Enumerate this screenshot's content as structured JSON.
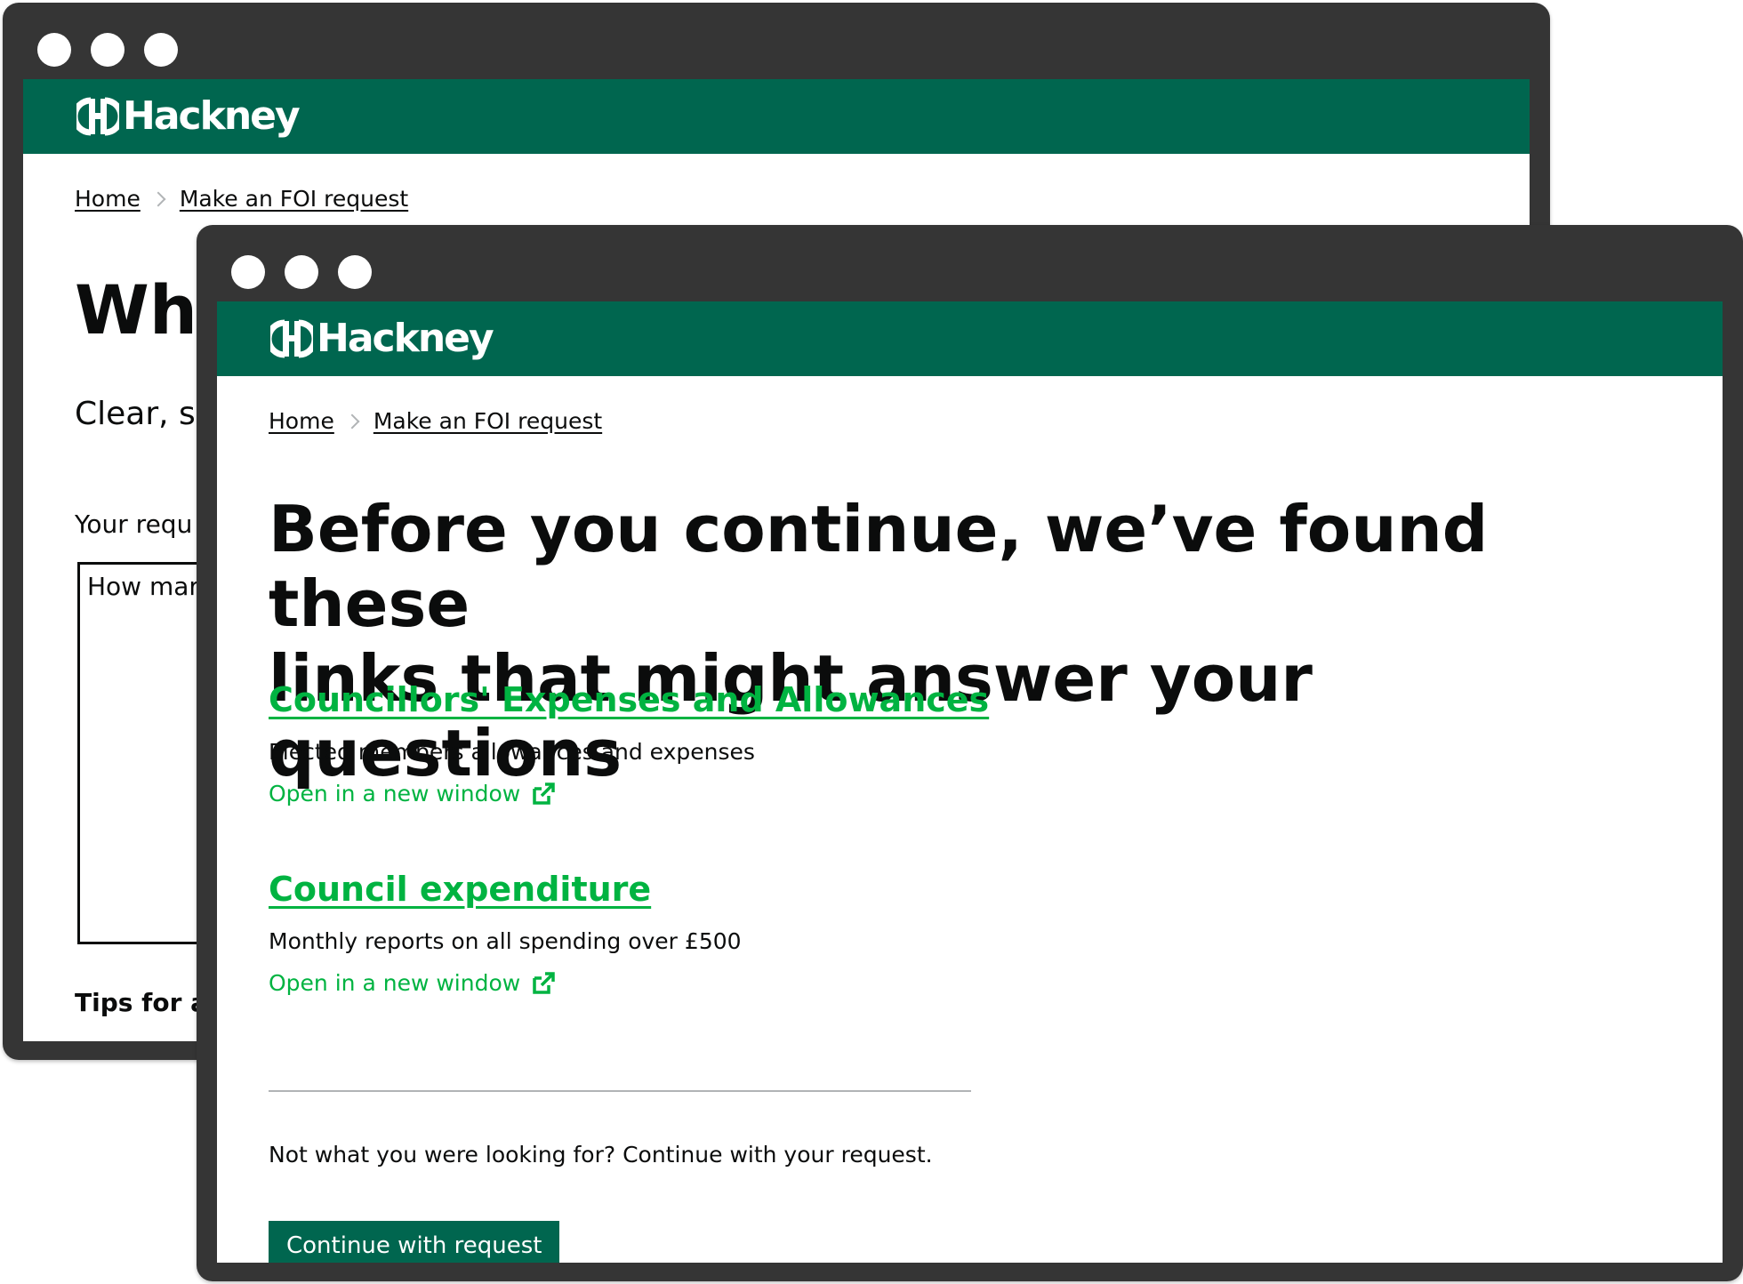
{
  "back_window": {
    "brand": "Hackney",
    "breadcrumb": {
      "home": "Home",
      "current": "Make an FOI request"
    },
    "heading_partial": "Wha",
    "intro_partial": "Clear, si",
    "field_label_partial": "Your requ",
    "textarea_value_partial": "How mar",
    "tips_partial": "Tips for a"
  },
  "front_window": {
    "brand": "Hackney",
    "breadcrumb": {
      "home": "Home",
      "current": "Make an FOI request"
    },
    "heading_line1": "Before you continue, we’ve found these",
    "heading_line2": "links that might answer your questions",
    "results": [
      {
        "title": "Councillors' Expenses and Allowances",
        "description": "Elected members allowances and expenses",
        "open_label": "Open in a new window"
      },
      {
        "title": "Council expenditure",
        "description": "Monthly reports on all spending over £500",
        "open_label": "Open in a new window"
      }
    ],
    "not_found_text": "Not what you were looking for? Continue with your request.",
    "continue_button": "Continue with request"
  },
  "colors": {
    "frame": "#353535",
    "header_green": "#00664f",
    "link_green": "#00b341",
    "text": "#0b0c0c"
  }
}
